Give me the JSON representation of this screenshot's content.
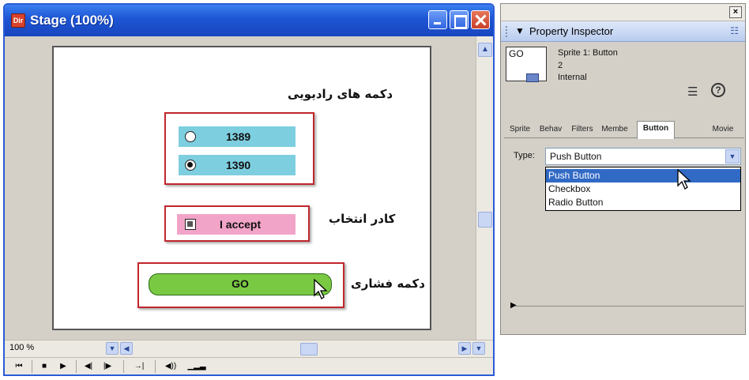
{
  "stage_window": {
    "title": "Stage (100%)",
    "app_icon_text": "Dir",
    "zoom": "100 %"
  },
  "stage_content": {
    "radio_heading": "دکمه های رادیویی",
    "radio_options": [
      {
        "label": "1389",
        "selected": false
      },
      {
        "label": "1390",
        "selected": true
      }
    ],
    "checkbox_heading": "کادر انتخاب",
    "checkbox_label": "I accept",
    "push_heading": "دکمه فشاری",
    "push_label": "GO"
  },
  "property_inspector": {
    "close_label": "×",
    "title": "Property Inspector",
    "thumb_text": "GO",
    "sprite_title": "Sprite 1: Button",
    "sprite_number": "2",
    "cast_name": "Internal",
    "tabs": [
      "Sprite",
      "Behav",
      "Filters",
      "Membe",
      "Button",
      "Movie"
    ],
    "active_tab": "Button",
    "type_label": "Type:",
    "type_value": "Push Button",
    "options": [
      "Push Button",
      "Checkbox",
      "Radio Button"
    ],
    "highlighted_option": "Push Button"
  },
  "colors": {
    "radio_bg": "#7dcfe0",
    "checkbox_bg": "#f2a4c8",
    "push_bg": "#7ac943",
    "highlight_box": "#c0272d",
    "selection": "#316ac5"
  }
}
